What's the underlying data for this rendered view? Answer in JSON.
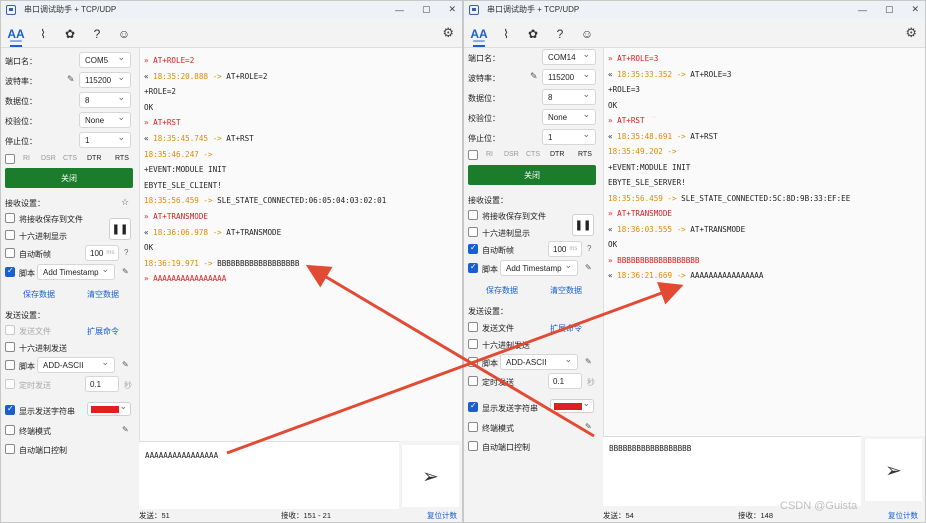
{
  "left_window": {
    "title": "串口调试助手 + TCP/UDP",
    "settings": {
      "port_label": "端口名：",
      "port_value": "COM5",
      "baud_label": "波特率：",
      "baud_value": "115200",
      "databits_label": "数据位：",
      "databits_value": "8",
      "parity_label": "校验位：",
      "parity_value": "None",
      "stopbits_label": "停止位：",
      "stopbits_value": "1",
      "signals": [
        "RI",
        "DSR",
        "CTS",
        "DTR",
        "RTS"
      ],
      "close_button": "关闭"
    },
    "receive": {
      "section_label": "接收设置：",
      "save_to_file": "将接收保存到文件",
      "hex_display": "十六进制显示",
      "auto_break": "自动断帧",
      "break_ms_value": "100",
      "ms_unit": "ms",
      "help": "?",
      "script_label": "脚本",
      "script_value": "Add Timestamp",
      "save_data": "保存数据",
      "clear_data": "清空数据"
    },
    "send": {
      "section_label": "发送设置：",
      "send_file": "发送文件",
      "expand_cmd": "扩展命令",
      "hex_send": "十六进制发送",
      "script_label": "脚本",
      "script_value": "ADD-ASCII",
      "timed_send": "定时发送",
      "timed_value": "0.1",
      "timed_unit": "秒",
      "show_send_chars": "显示发送字符串",
      "terminal_mode": "终端模式",
      "auto_port_ctrl": "自动端口控制"
    },
    "log": [
      {
        "c": "red",
        "t": "» AT+ROLE=2"
      },
      {
        "c": "mix",
        "p": "« ",
        "ts": "18:35:20.888 ->",
        "t": " AT+ROLE=2"
      },
      {
        "c": "ink",
        "t": "+ROLE=2"
      },
      {
        "c": "ink",
        "t": "OK"
      },
      {
        "c": "red",
        "t": "» AT+RST"
      },
      {
        "c": "mix",
        "p": "« ",
        "ts": "18:35:45.745 ->",
        "t": " AT+RST"
      },
      {
        "c": "orange",
        "t": "18:35:46.247 ->"
      },
      {
        "c": "ink",
        "t": "+EVENT:MODULE INIT"
      },
      {
        "c": "ink",
        "t": "EBYTE_SLE_CLIENT!"
      },
      {
        "c": "mix",
        "p": "",
        "ts": "18:35:56.459 ->",
        "t": " SLE_STATE_CONNECTED:06:05:04:03:02:01"
      },
      {
        "c": "red",
        "t": "» AT+TRANSMODE"
      },
      {
        "c": "mix",
        "p": "« ",
        "ts": "18:36:06.978 ->",
        "t": " AT+TRANSMODE"
      },
      {
        "c": "ink",
        "t": "OK"
      },
      {
        "c": "mix",
        "p": "",
        "ts": "18:36:19.971 ->",
        "t": " BBBBBBBBBBBBBBBBBB"
      },
      {
        "c": "red",
        "t": "» AAAAAAAAAAAAAAAA"
      }
    ],
    "send_text": "AAAAAAAAAAAAAAAA",
    "status": {
      "sent": "发送：51",
      "recv": "接收：151 - 21",
      "reset": "复位计数"
    }
  },
  "right_window": {
    "title": "串口调试助手 + TCP/UDP",
    "settings": {
      "port_label": "端口名：",
      "port_value": "COM14",
      "baud_label": "波特率：",
      "baud_value": "115200",
      "databits_label": "数据位：",
      "databits_value": "8",
      "parity_label": "校验位：",
      "parity_value": "None",
      "stopbits_label": "停止位：",
      "stopbits_value": "1",
      "signals": [
        "RI",
        "DSR",
        "CTS",
        "DTR",
        "RTS"
      ],
      "close_button": "关闭"
    },
    "receive": {
      "section_label": "接收设置：",
      "save_to_file": "将接收保存到文件",
      "hex_display": "十六进制显示",
      "auto_break": "自动断帧",
      "break_ms_value": "100",
      "ms_unit": "ms",
      "help": "?",
      "script_label": "脚本",
      "script_value": "Add Timestamp",
      "save_data": "保存数据",
      "clear_data": "清空数据"
    },
    "send": {
      "section_label": "发送设置：",
      "send_file": "发送文件",
      "expand_cmd": "扩展命令",
      "hex_send": "十六进制发送",
      "script_label": "脚本",
      "script_value": "ADD-ASCII",
      "timed_send": "定时发送",
      "timed_value": "0.1",
      "timed_unit": "秒",
      "show_send_chars": "显示发送字符串",
      "terminal_mode": "终端模式",
      "auto_port_ctrl": "自动端口控制"
    },
    "log": [
      {
        "c": "red",
        "t": "» AT+ROLE=3"
      },
      {
        "c": "mix",
        "p": "« ",
        "ts": "18:35:33.352 ->",
        "t": " AT+ROLE=3"
      },
      {
        "c": "ink",
        "t": "+ROLE=3"
      },
      {
        "c": "ink",
        "t": "OK"
      },
      {
        "c": "red",
        "t": "» AT+RST"
      },
      {
        "c": "mix",
        "p": "« ",
        "ts": "18:35:48.691 ->",
        "t": " AT+RST"
      },
      {
        "c": "orange",
        "t": "18:35:49.202 ->"
      },
      {
        "c": "ink",
        "t": "+EVENT:MODULE INIT"
      },
      {
        "c": "ink",
        "t": "EBYTE_SLE_SERVER!"
      },
      {
        "c": "mix",
        "p": "",
        "ts": "18:35:56.459 ->",
        "t": " SLE_STATE_CONNECTED:5C:8D:9B:33:EF:EE"
      },
      {
        "c": "red",
        "t": "» AT+TRANSMODE"
      },
      {
        "c": "mix",
        "p": "« ",
        "ts": "18:36:03.555 ->",
        "t": " AT+TRANSMODE"
      },
      {
        "c": "ink",
        "t": "OK"
      },
      {
        "c": "red",
        "t": "» BBBBBBBBBBBBBBBBBB"
      },
      {
        "c": "mix",
        "p": "« ",
        "ts": "18:36:21.669 ->",
        "t": " AAAAAAAAAAAAAAAA"
      }
    ],
    "send_text": "BBBBBBBBBBBBBBBBBB",
    "status": {
      "sent": "发送：54",
      "recv": "接收：148",
      "reset": "复位计数"
    }
  },
  "watermark": "CSDN @Guista",
  "colors": {
    "accent": "#1a5fd0",
    "close_button": "#1b7d2b",
    "sent": "#d92020",
    "timestamp": "#e08a00",
    "arrow": "#e24a33"
  }
}
